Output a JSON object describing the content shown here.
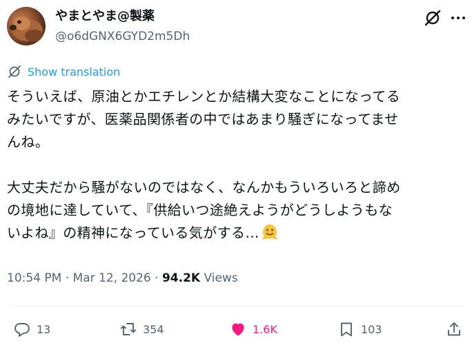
{
  "author": {
    "display_name": "やまとやま@製薬",
    "handle": "@o6dGNX6GYD2m5Dh"
  },
  "translate_label": "Show translation",
  "tweet": {
    "lines": [
      "そういえば、原油とかエチレンとか結構大変なことになってる",
      "みたいですが、医薬品関係者の中ではあまり騒ぎになってませ",
      "んね。",
      "",
      "大丈夫だから騒がないのではなく、なんかもういろいろと諦め",
      "の境地に達していて、『供給いつ途絶えようがどうしようもな",
      "いよね』の精神になっている気がする…"
    ],
    "emoji_name": "melting-face-emoji"
  },
  "meta": {
    "time": "10:54 PM",
    "separator": "·",
    "date": "Mar 12, 2026",
    "views_count": "94.2K",
    "views_label": "Views"
  },
  "actions": {
    "replies": "13",
    "reposts": "354",
    "likes": "1.6K",
    "bookmarks": "103"
  },
  "icons": {
    "grok": "grok-icon",
    "more": "more-icon",
    "translate": "translate-icon",
    "reply": "reply-icon",
    "repost": "repost-icon",
    "like": "heart-icon",
    "bookmark": "bookmark-icon",
    "share": "share-icon"
  },
  "colors": {
    "text": "#0f1419",
    "secondary": "#536471",
    "link": "#1d9bf0",
    "like": "#f91880",
    "divider": "#eff3f4",
    "emoji": "#f7c53c"
  }
}
